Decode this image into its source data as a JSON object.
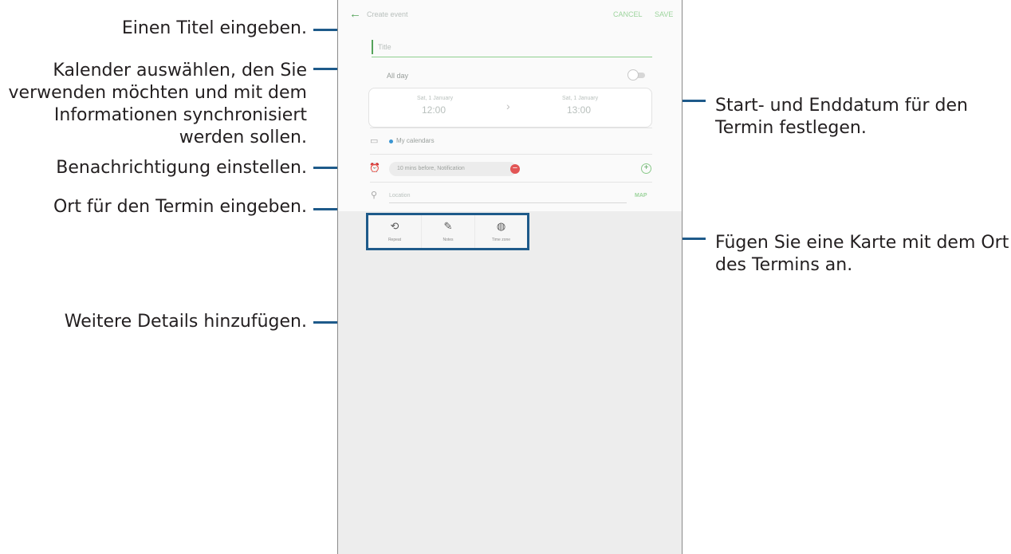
{
  "callouts": {
    "title": "Einen Titel eingeben.",
    "calendar_lines": [
      "Kalender auswählen, den Sie",
      "verwenden möchten und mit dem",
      "Informationen synchronisiert",
      "werden sollen."
    ],
    "notification": "Benachrichtigung einstellen.",
    "location": "Ort für den Termin eingeben.",
    "details": "Weitere Details hinzufügen.",
    "dates_lines": [
      "Start- und Enddatum für den",
      "Termin festlegen."
    ],
    "map_lines": [
      "Fügen Sie eine Karte mit dem Ort",
      "des Termins an."
    ]
  },
  "app": {
    "header": {
      "back_icon": "arrow-left-icon",
      "title": "Create event",
      "cancel_label": "CANCEL",
      "save_label": "SAVE"
    },
    "title_placeholder": "Title",
    "all_day_label": "All day",
    "all_day_on": false,
    "start": {
      "date": "Sat, 1 January",
      "time": "12:00"
    },
    "end": {
      "date": "Sat, 1 January",
      "time": "13:00"
    },
    "calendar_label": "My calendars",
    "calendar_color": "#3a95d2",
    "notification_label": "10 mins before, Notification",
    "location_placeholder": "Location",
    "map_label": "MAP",
    "detail_buttons": [
      {
        "icon": "repeat-icon",
        "label": "Repeat"
      },
      {
        "icon": "notes-icon",
        "label": "Notes"
      },
      {
        "icon": "time-zone-icon",
        "label": "Time zone"
      }
    ]
  },
  "colors": {
    "accent": "#55a35a",
    "callout_line": "#1e5a8a"
  }
}
